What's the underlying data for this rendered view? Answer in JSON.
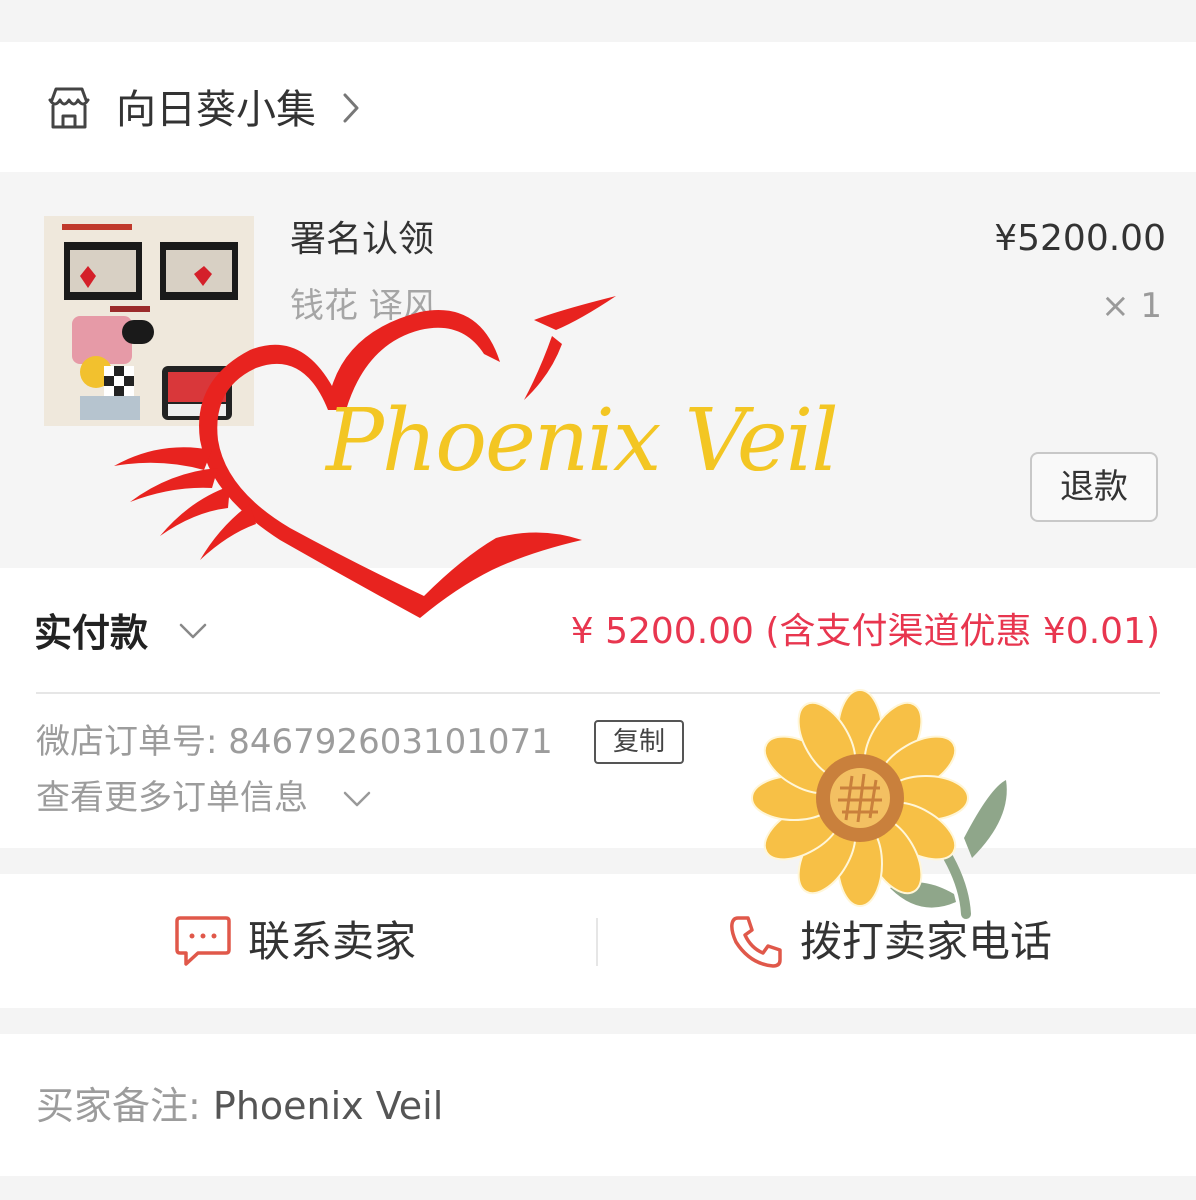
{
  "shop": {
    "name": "向日葵小集"
  },
  "product": {
    "title": "署名认领",
    "spec": "钱花 译风",
    "price": "¥5200.00",
    "quantity": "× 1",
    "refund_label": "退款"
  },
  "payment": {
    "label": "实付款",
    "amount": "¥ 5200.00 (含支付渠道优惠 ¥0.01)"
  },
  "order": {
    "number_label": "微店订单号:",
    "number": "846792603101071",
    "copy_label": "复制",
    "more_info": "查看更多订单信息"
  },
  "contact": {
    "contact_seller": "联系卖家",
    "call_seller": "拨打卖家电话"
  },
  "note": {
    "label": "买家备注:",
    "value": "Phoenix Veil"
  },
  "watermark": {
    "text": "Phoenix Veil"
  },
  "colors": {
    "accent": "#e8364f",
    "heart": "#e8231f",
    "watermark_text": "#f3c623"
  },
  "icons": [
    "shop-icon",
    "chevron-right-icon",
    "chevron-down-icon",
    "chat-bubble-icon",
    "phone-icon"
  ]
}
